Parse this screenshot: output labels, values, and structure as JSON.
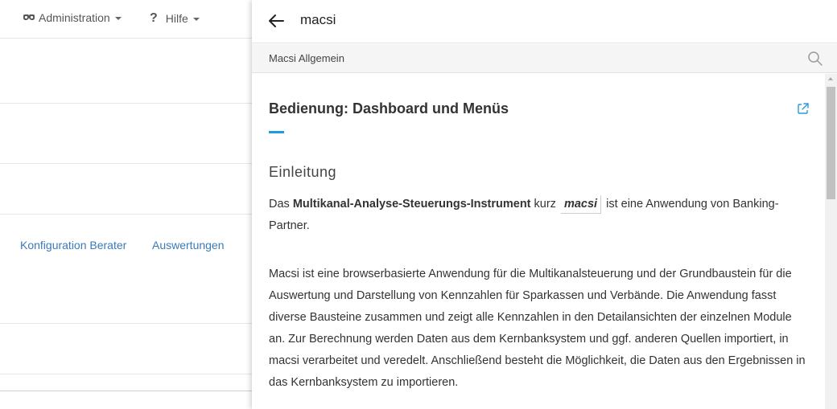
{
  "background": {
    "menu_admin": "Administration",
    "menu_help": "Hilfe",
    "link_config": "Konfiguration Berater",
    "link_reports": "Auswertungen"
  },
  "panel": {
    "title": "macsi",
    "breadcrumb": "Macsi Allgemein",
    "doc_title": "Bedienung: Dashboard und Menüs",
    "section_heading": "Einleitung",
    "para1_before": "Das ",
    "para1_bold": "Multikanal-Analyse-Steuerungs-Instrument",
    "para1_mid": " kurz ",
    "para1_tag": "macsi",
    "para1_after": " ist eine Anwendung von Banking-Partner.",
    "para2": "Macsi ist eine browserbasierte Anwendung für die Multikanalsteuerung und der Grundbaustein für die Auswertung und Darstellung von Kennzahlen für Sparkassen und Verbände. Die Anwendung fasst diverse Bausteine zusammen und zeigt alle Kennzahlen in den Detailansichten der einzelnen Module an. Zur Berechnung werden Daten aus dem Kernbanksystem und ggf. anderen Quellen importiert, in macsi verarbeitet und veredelt. Anschließend besteht die Möglichkeit, die Daten aus den Ergebnissen in das Kernbanksystem zu importieren."
  },
  "icons": {
    "back": "arrow-left-icon",
    "search": "search-icon",
    "external": "external-link-icon",
    "mask": "mask-icon",
    "help": "question-icon"
  },
  "colors": {
    "accent": "#1f9be0",
    "link": "#3a7ab8"
  }
}
